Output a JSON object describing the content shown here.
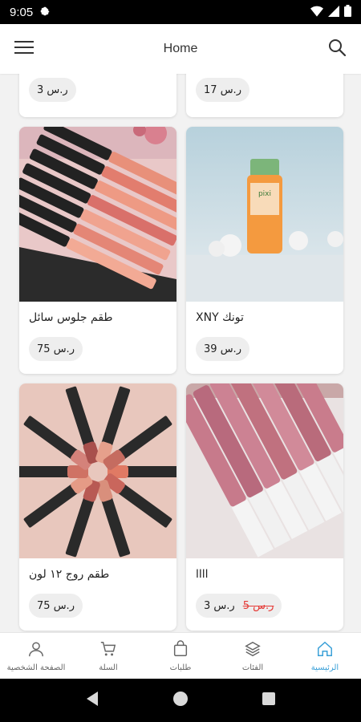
{
  "status": {
    "time": "9:05"
  },
  "header": {
    "title": "Home"
  },
  "products": [
    {
      "name": "",
      "price": "3 ر.س"
    },
    {
      "name": "",
      "price": "17 ر.س"
    },
    {
      "name": "طقم جلوس سائل",
      "price": "75 ر.س",
      "image": "lipgloss-set-photo"
    },
    {
      "name": "تونك XNY",
      "price": "39 ر.س",
      "image": "toner-bottle-photo"
    },
    {
      "name": "طقم روج ١٢ لون",
      "price": "75 ر.س",
      "image": "lipstick-circle-photo"
    },
    {
      "name": "اااا",
      "price": "3 ر.س",
      "old_price": "5 ر.س",
      "image": "pink-gloss-photo"
    }
  ],
  "nav": {
    "items": [
      {
        "label": "الصفحة الشخصية",
        "icon": "person-icon"
      },
      {
        "label": "السلة",
        "icon": "cart-icon"
      },
      {
        "label": "طلبات",
        "icon": "bag-icon"
      },
      {
        "label": "الفئات",
        "icon": "layers-icon"
      },
      {
        "label": "الرئيسية",
        "icon": "home-icon"
      }
    ],
    "active_color": "#3aa0d8"
  },
  "colors": {
    "sale_price": "#e53935"
  }
}
